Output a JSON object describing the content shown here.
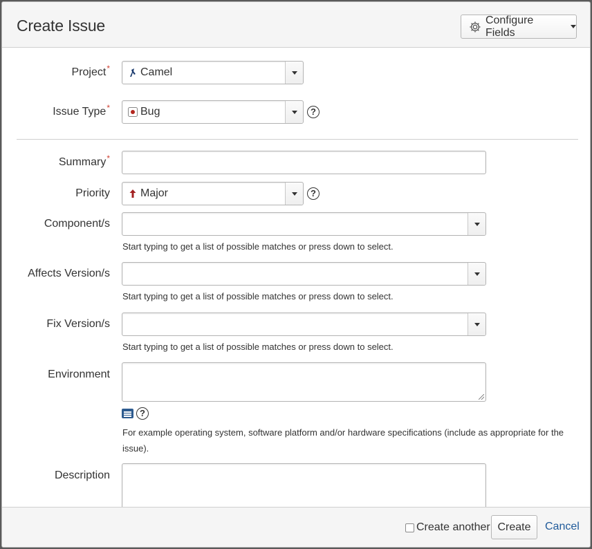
{
  "dialog": {
    "title": "Create Issue",
    "configure_fields_label": "Configure Fields"
  },
  "fields": {
    "project": {
      "label": "Project",
      "required": "*",
      "value": "Camel",
      "icon": "camel-project-icon"
    },
    "issue_type": {
      "label": "Issue Type",
      "required": "*",
      "value": "Bug",
      "icon": "bug-icon"
    },
    "summary": {
      "label": "Summary",
      "required": "*",
      "value": ""
    },
    "priority": {
      "label": "Priority",
      "value": "Major",
      "icon": "arrow-up-icon"
    },
    "components": {
      "label": "Component/s",
      "value": "",
      "hint": "Start typing to get a list of possible matches or press down to select."
    },
    "affects_versions": {
      "label": "Affects Version/s",
      "value": "",
      "hint": "Start typing to get a list of possible matches or press down to select."
    },
    "fix_versions": {
      "label": "Fix Version/s",
      "value": "",
      "hint": "Start typing to get a list of possible matches or press down to select."
    },
    "environment": {
      "label": "Environment",
      "value": "",
      "hint": "For example operating system, software platform and/or hardware specifications (include as appropriate for the issue)."
    },
    "description": {
      "label": "Description",
      "value": ""
    }
  },
  "help_glyph": "?",
  "footer": {
    "create_another_label": "Create another",
    "create_label": "Create",
    "cancel_label": "Cancel"
  },
  "colors": {
    "required": "#d04437",
    "link": "#1f5a9a",
    "priority_major": "#a32121",
    "bug": "#b3261e"
  }
}
